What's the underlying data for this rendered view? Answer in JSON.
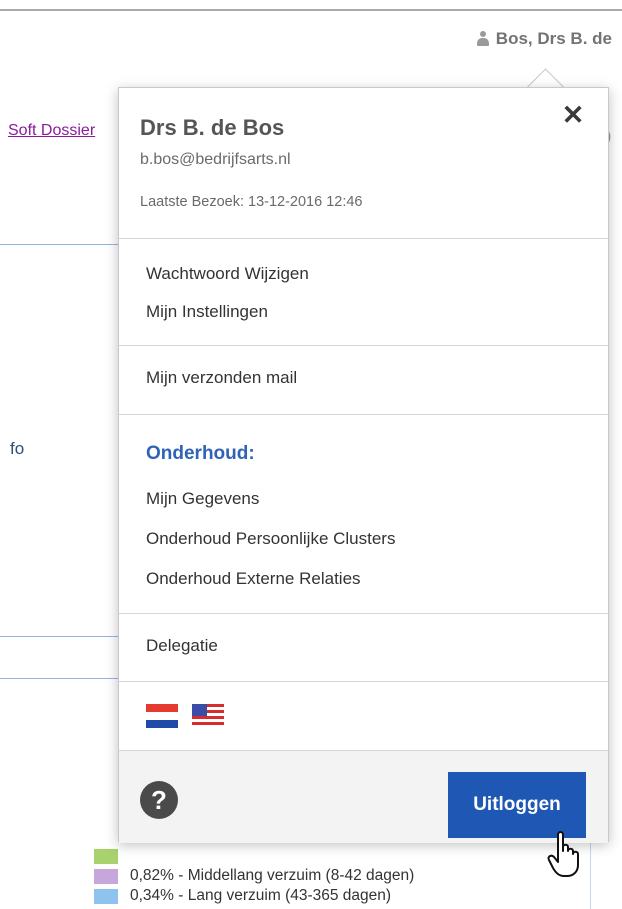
{
  "header": {
    "user_menu_label": "Bos, Drs B. de"
  },
  "background": {
    "link_text": "Soft Dossier",
    "info_fragment": "fo",
    "right_fragment": ")",
    "legend": [
      {
        "label": "0,82% - Middellang verzuim (8-42 dagen)",
        "color": "#c7a6dc"
      },
      {
        "label": "0,34% - Lang verzuim (43-365 dagen)",
        "color": "#8fc2ec"
      }
    ],
    "legend_top_swatch_color": "#a8d26b"
  },
  "popup": {
    "user_name": "Drs B. de Bos",
    "email": "b.bos@bedrijfsarts.nl",
    "last_visit": "Laatste Bezoek: 13-12-2016 12:46",
    "close_symbol": "✕",
    "account_items": [
      "Wachtwoord Wijzigen",
      "Mijn Instellingen"
    ],
    "mail_item": "Mijn verzonden mail",
    "maintenance_heading": "Onderhoud:",
    "maintenance_items": [
      "Mijn Gegevens",
      "Onderhoud Persoonlijke Clusters",
      "Onderhoud Externe Relaties"
    ],
    "delegation_item": "Delegatie",
    "languages": [
      {
        "icon": "flag-netherlands-icon"
      },
      {
        "icon": "flag-united-states-icon"
      }
    ],
    "help_symbol": "?",
    "logout_label": "Uitloggen"
  },
  "colors": {
    "accent": "#1e57b4",
    "heading": "#2f63b6",
    "footer_bg": "#f3f3f3"
  }
}
